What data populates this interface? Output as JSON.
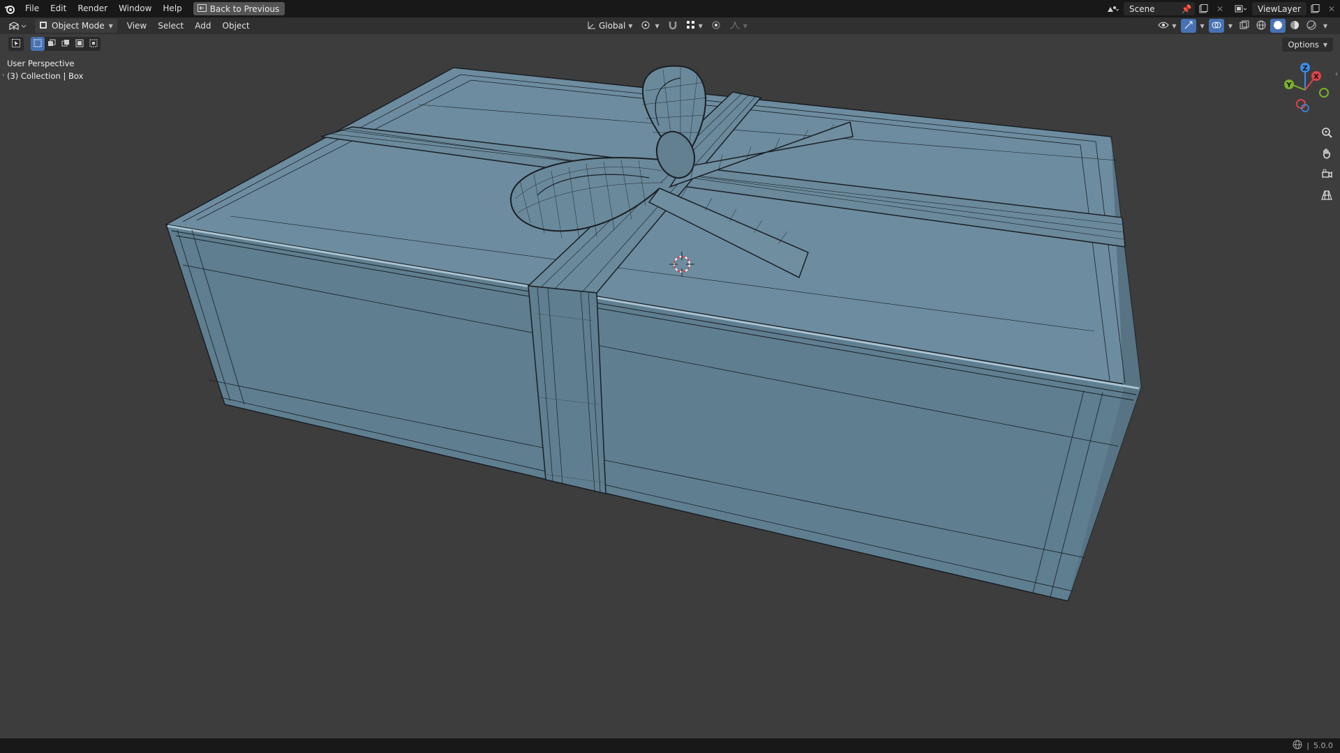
{
  "topbar": {
    "menus": [
      "File",
      "Edit",
      "Render",
      "Window",
      "Help"
    ],
    "back_label": "Back to Previous",
    "scene_name": "Scene",
    "view_layer": "ViewLayer"
  },
  "header": {
    "mode": "Object Mode",
    "menus": [
      "View",
      "Select",
      "Add",
      "Object"
    ],
    "orientation": "Global"
  },
  "viewport": {
    "perspective": "User Perspective",
    "collection": "(3) Collection | Box",
    "options_label": "Options",
    "gizmo_axes": [
      "Z",
      "X",
      "Y"
    ],
    "nav_icons": [
      "zoom-icon",
      "hand-pan-icon",
      "camera-icon",
      "grid-ortho-icon"
    ]
  },
  "status": {
    "version": "5.0.0"
  },
  "colors": {
    "box_top": "#6e8ea0",
    "box_front": "#5f7d8f",
    "box_side": "#5a7788",
    "wire": "#1a1f24",
    "accent": "#4772b3",
    "axis_x": "#e0424b",
    "axis_y": "#7bb02c",
    "axis_z": "#3d8ce6"
  }
}
